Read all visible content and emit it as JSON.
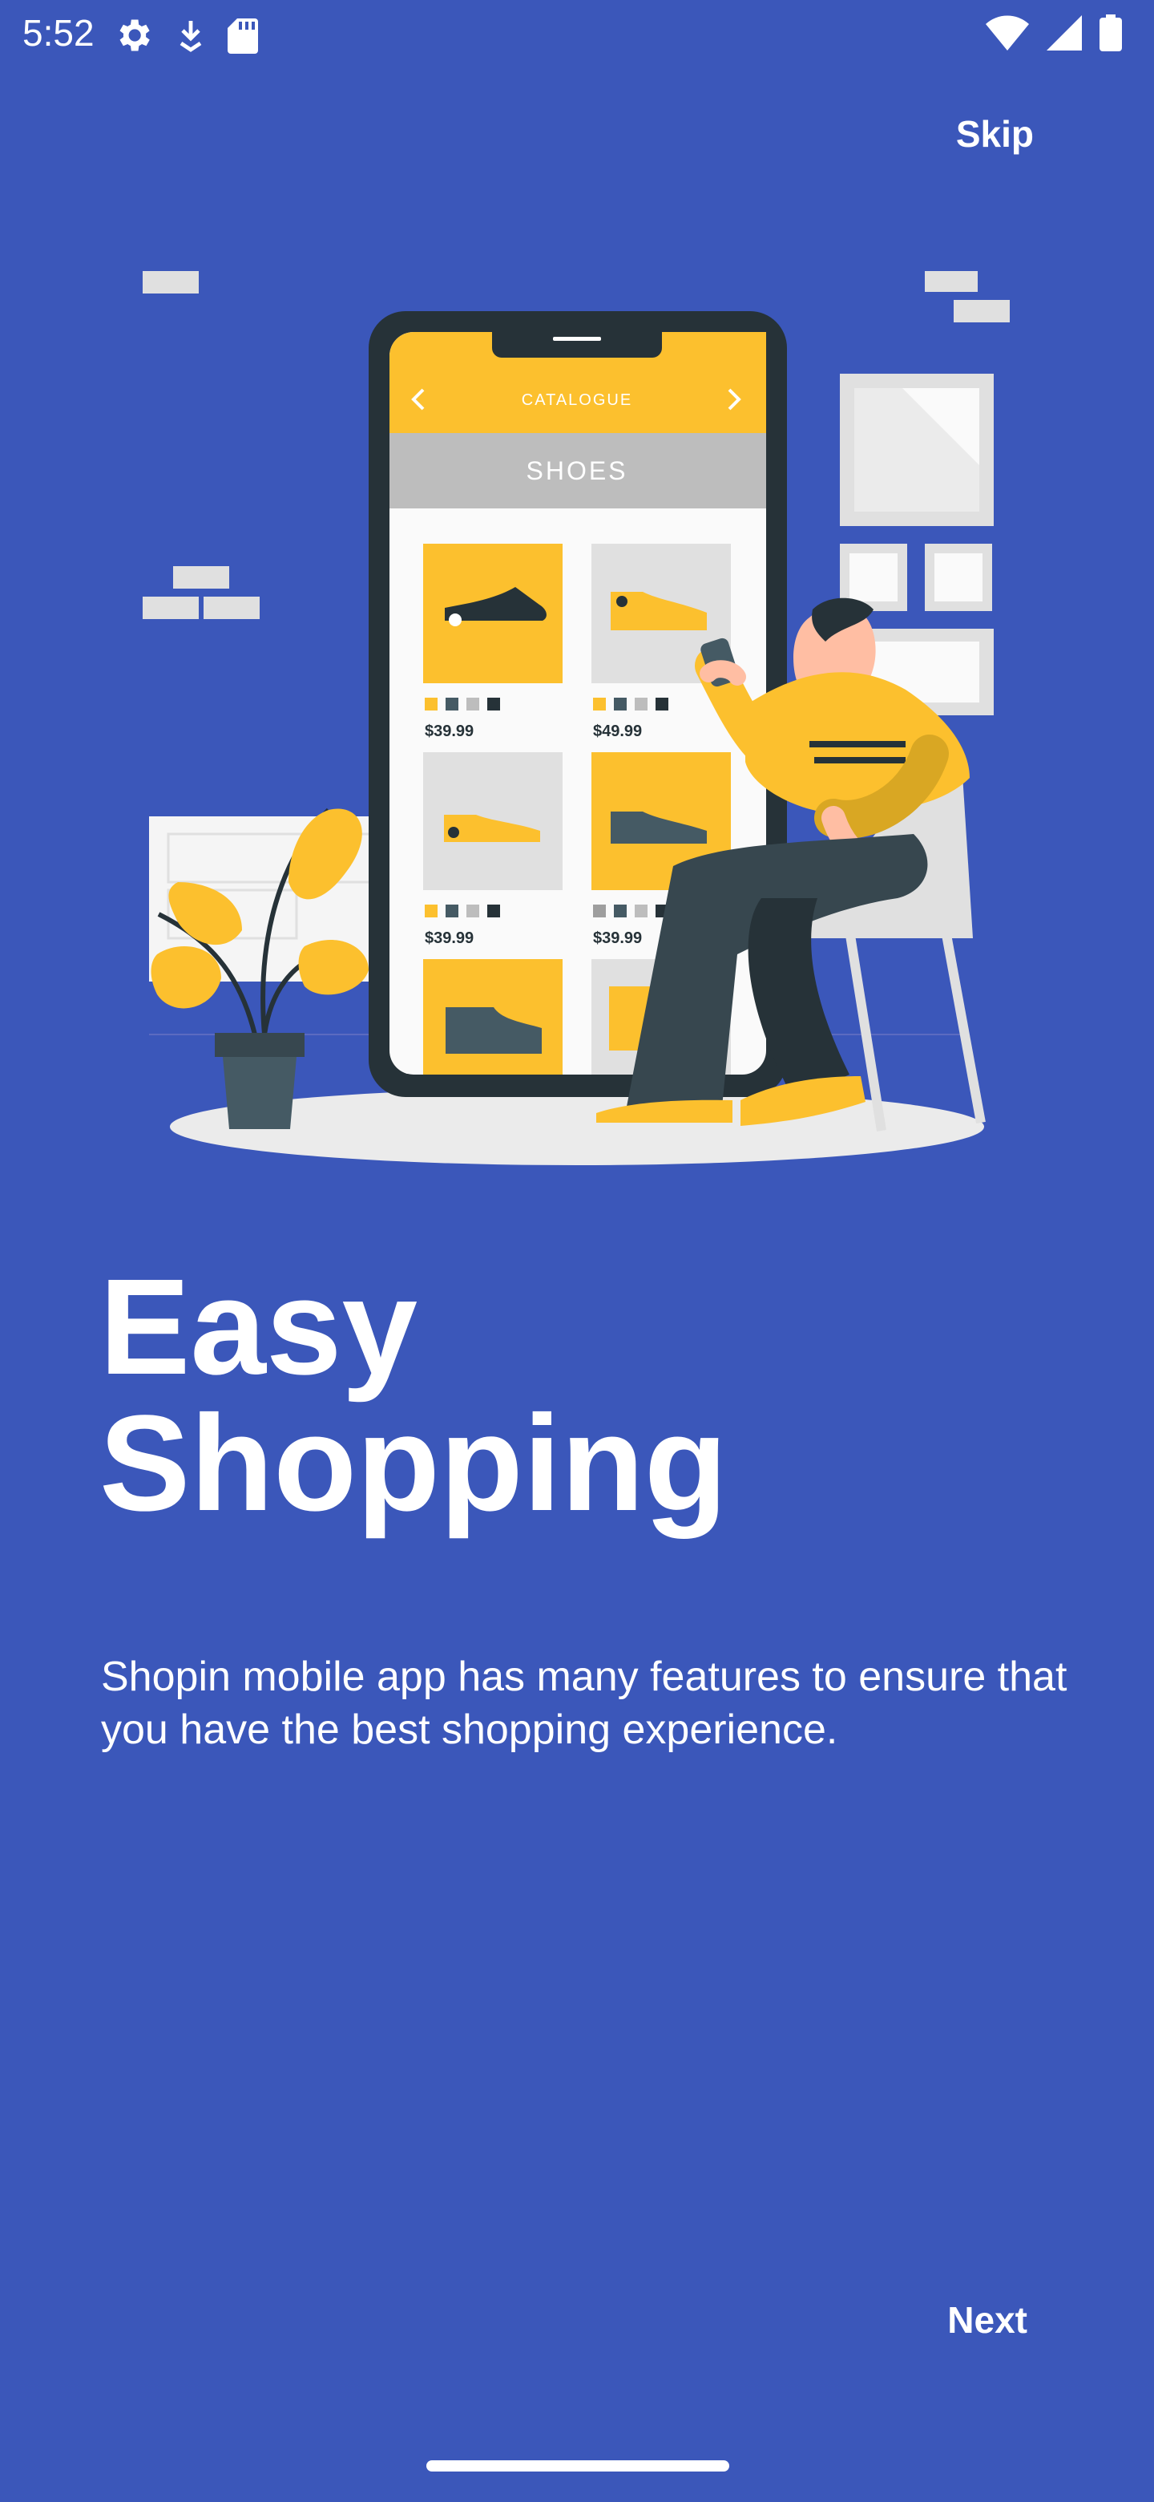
{
  "status_bar": {
    "time": "5:52",
    "left_icons": [
      "gear-icon",
      "download-icon",
      "sd-card-icon"
    ],
    "right_icons": [
      "wifi-icon",
      "signal-icon",
      "battery-icon"
    ]
  },
  "header": {
    "skip_label": "Skip"
  },
  "illustration": {
    "phone_header_title": "CATALOGUE",
    "category": "SHOES",
    "prices": [
      "$39.99",
      "$49.99",
      "$39.99",
      "$39.99"
    ]
  },
  "onboarding": {
    "title_line1": "Easy",
    "title_line2": "Shopping",
    "description": "Shopin mobile app has many features to ensure that you have the best shopping experience."
  },
  "footer": {
    "next_label": "Next"
  },
  "colors": {
    "background": "#3B57BA",
    "accent_yellow": "#FCC02E",
    "dark": "#263238",
    "text": "#FFFFFF"
  }
}
